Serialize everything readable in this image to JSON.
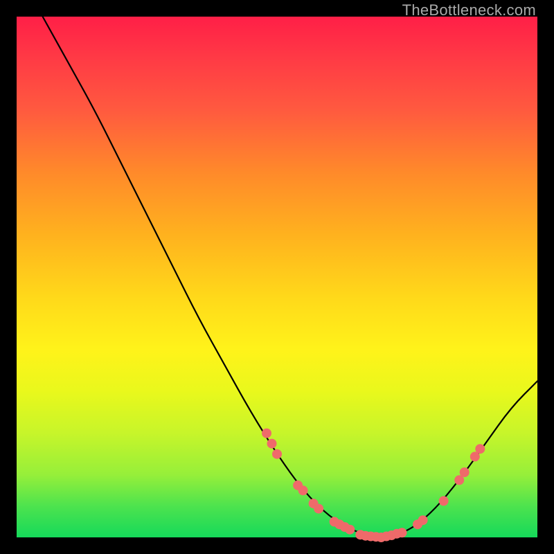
{
  "watermark": "TheBottleneck.com",
  "chart_data": {
    "type": "line",
    "title": "",
    "xlabel": "",
    "ylabel": "",
    "xlim": [
      0,
      100
    ],
    "ylim": [
      0,
      100
    ],
    "series": [
      {
        "name": "bottleneck-curve",
        "points": [
          {
            "x": 5,
            "y": 100
          },
          {
            "x": 10,
            "y": 91
          },
          {
            "x": 15,
            "y": 82
          },
          {
            "x": 20,
            "y": 72
          },
          {
            "x": 25,
            "y": 62
          },
          {
            "x": 30,
            "y": 52
          },
          {
            "x": 35,
            "y": 42
          },
          {
            "x": 40,
            "y": 33
          },
          {
            "x": 45,
            "y": 24
          },
          {
            "x": 50,
            "y": 16
          },
          {
            "x": 55,
            "y": 9
          },
          {
            "x": 60,
            "y": 4
          },
          {
            "x": 65,
            "y": 1
          },
          {
            "x": 70,
            "y": 0
          },
          {
            "x": 75,
            "y": 1
          },
          {
            "x": 80,
            "y": 5
          },
          {
            "x": 85,
            "y": 11
          },
          {
            "x": 90,
            "y": 18
          },
          {
            "x": 95,
            "y": 25
          },
          {
            "x": 100,
            "y": 30
          }
        ]
      }
    ],
    "markers": [
      {
        "x": 48,
        "y": 20
      },
      {
        "x": 49,
        "y": 18
      },
      {
        "x": 50,
        "y": 16
      },
      {
        "x": 54,
        "y": 10
      },
      {
        "x": 55,
        "y": 9
      },
      {
        "x": 57,
        "y": 6.5
      },
      {
        "x": 58,
        "y": 5.5
      },
      {
        "x": 61,
        "y": 3
      },
      {
        "x": 62,
        "y": 2.5
      },
      {
        "x": 63,
        "y": 2
      },
      {
        "x": 64,
        "y": 1.5
      },
      {
        "x": 66,
        "y": 0.5
      },
      {
        "x": 67,
        "y": 0.3
      },
      {
        "x": 68,
        "y": 0.2
      },
      {
        "x": 69,
        "y": 0.1
      },
      {
        "x": 70,
        "y": 0
      },
      {
        "x": 71,
        "y": 0.2
      },
      {
        "x": 72,
        "y": 0.4
      },
      {
        "x": 73,
        "y": 0.7
      },
      {
        "x": 74,
        "y": 0.9
      },
      {
        "x": 77,
        "y": 2.5
      },
      {
        "x": 78,
        "y": 3.3
      },
      {
        "x": 82,
        "y": 7
      },
      {
        "x": 85,
        "y": 11
      },
      {
        "x": 86,
        "y": 12.5
      },
      {
        "x": 88,
        "y": 15.5
      },
      {
        "x": 89,
        "y": 17
      }
    ],
    "background_gradient": {
      "direction": "vertical",
      "stops": [
        {
          "pos": 0,
          "color": "#ff1f47"
        },
        {
          "pos": 50,
          "color": "#ffe01a"
        },
        {
          "pos": 100,
          "color": "#15d95a"
        }
      ]
    }
  }
}
